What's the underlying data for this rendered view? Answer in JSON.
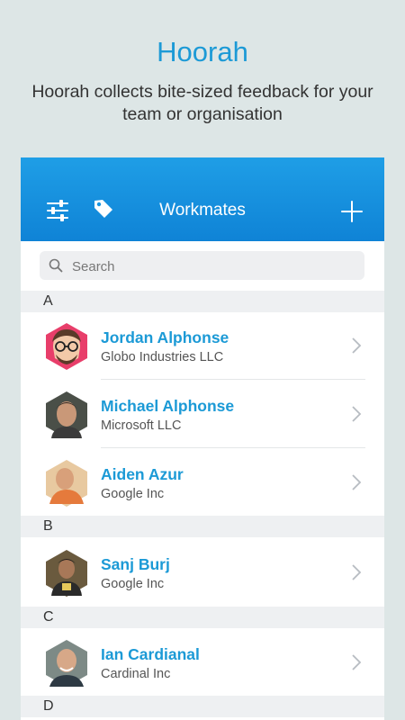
{
  "promo": {
    "title": "Hoorah",
    "subtitle": "Hoorah collects bite-sized feedback for your team or organisation"
  },
  "navbar": {
    "title": "Workmates",
    "icons": [
      "filter-sliders-icon",
      "tag-icon",
      "add-icon"
    ]
  },
  "search": {
    "placeholder": "Search",
    "value": ""
  },
  "colors": {
    "accent": "#1c9ad6",
    "nav_top": "#1f9ee6",
    "nav_bottom": "#0f83d6",
    "background": "#dde6e6"
  },
  "sections": [
    {
      "letter": "A",
      "contacts": [
        {
          "name": "Jordan Alphonse",
          "company": "Globo Industries LLC"
        },
        {
          "name": "Michael Alphonse",
          "company": "Microsoft LLC"
        },
        {
          "name": "Aiden Azur",
          "company": "Google Inc"
        }
      ]
    },
    {
      "letter": "B",
      "contacts": [
        {
          "name": "Sanj Burj",
          "company": "Google Inc"
        }
      ]
    },
    {
      "letter": "C",
      "contacts": [
        {
          "name": "Ian Cardianal",
          "company": "Cardinal Inc"
        }
      ]
    },
    {
      "letter": "D",
      "contacts": []
    }
  ]
}
